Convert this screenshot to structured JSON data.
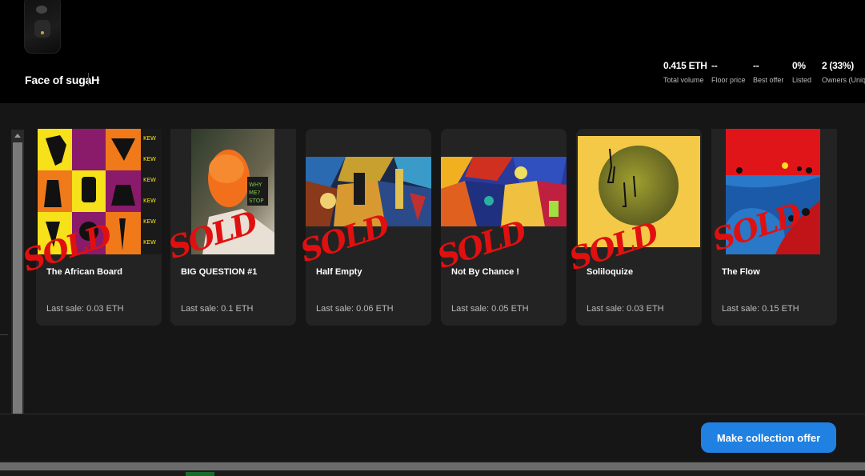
{
  "collection": {
    "name": "Face of sugaH",
    "more_label": "..."
  },
  "stats": [
    {
      "value": "0.415 ETH",
      "label": "Total volume"
    },
    {
      "value": "--",
      "label": "Floor price"
    },
    {
      "value": "--",
      "label": "Best offer"
    },
    {
      "value": "0%",
      "label": "Listed"
    },
    {
      "value": "2 (33%)",
      "label": "Owners (Unique)"
    }
  ],
  "items": [
    {
      "title": "The African Board",
      "last_sale": "Last sale: 0.03 ETH",
      "badge": "SOLD"
    },
    {
      "title": "BIG QUESTION #1",
      "last_sale": "Last sale: 0.1 ETH",
      "badge": "SOLD"
    },
    {
      "title": "Half Empty",
      "last_sale": "Last sale: 0.06 ETH",
      "badge": "SOLD"
    },
    {
      "title": "Not By Chance !",
      "last_sale": "Last sale: 0.05 ETH",
      "badge": "SOLD"
    },
    {
      "title": "Soliloquize",
      "last_sale": "Last sale: 0.03 ETH",
      "badge": "SOLD"
    },
    {
      "title": "The Flow",
      "last_sale": "Last sale: 0.15 ETH",
      "badge": "SOLD"
    }
  ],
  "actions": {
    "make_offer_label": "Make collection offer"
  },
  "colors": {
    "accent": "#2081e2",
    "sold_stamp": "#e01010",
    "card_bg": "#232323"
  }
}
